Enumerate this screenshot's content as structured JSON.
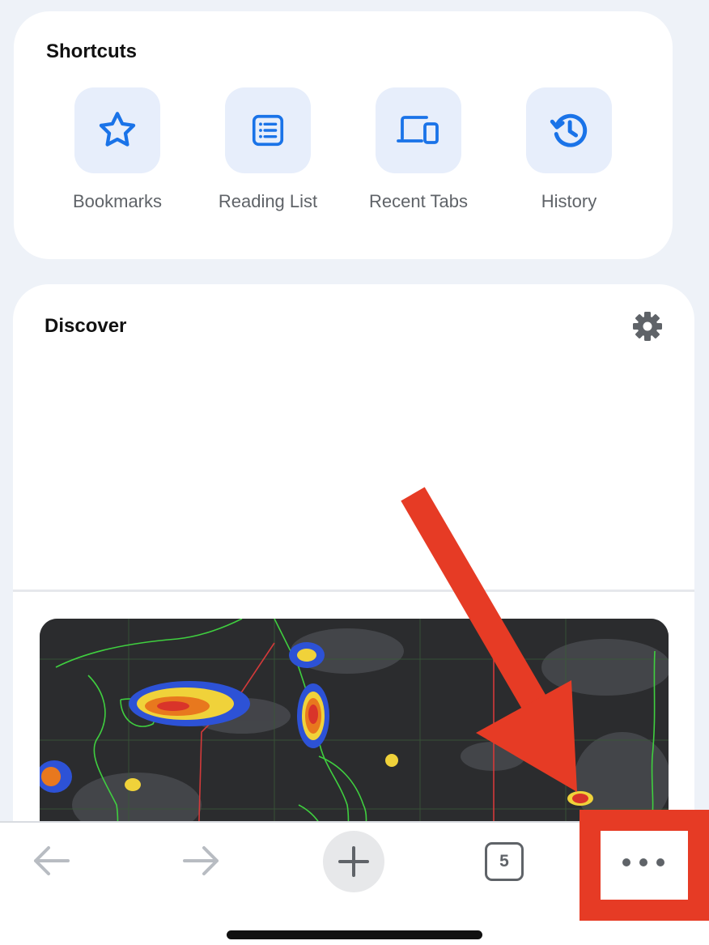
{
  "shortcuts": {
    "title": "Shortcuts",
    "items": [
      {
        "label": "Bookmarks",
        "icon": "star-icon"
      },
      {
        "label": "Reading List",
        "icon": "reading-list-icon"
      },
      {
        "label": "Recent Tabs",
        "icon": "devices-icon"
      },
      {
        "label": "History",
        "icon": "history-icon"
      }
    ]
  },
  "discover": {
    "title": "Discover",
    "settings_icon": "gear-icon"
  },
  "toolbar": {
    "back_icon": "arrow-left-icon",
    "forward_icon": "arrow-right-icon",
    "new_tab_icon": "plus-icon",
    "tab_count": "5",
    "menu_icon": "more-dots-icon"
  },
  "colors": {
    "accent": "#1a73e8",
    "tile_bg": "#e7eefb",
    "annotation": "#e63b25",
    "page_bg": "#eef2f8"
  }
}
